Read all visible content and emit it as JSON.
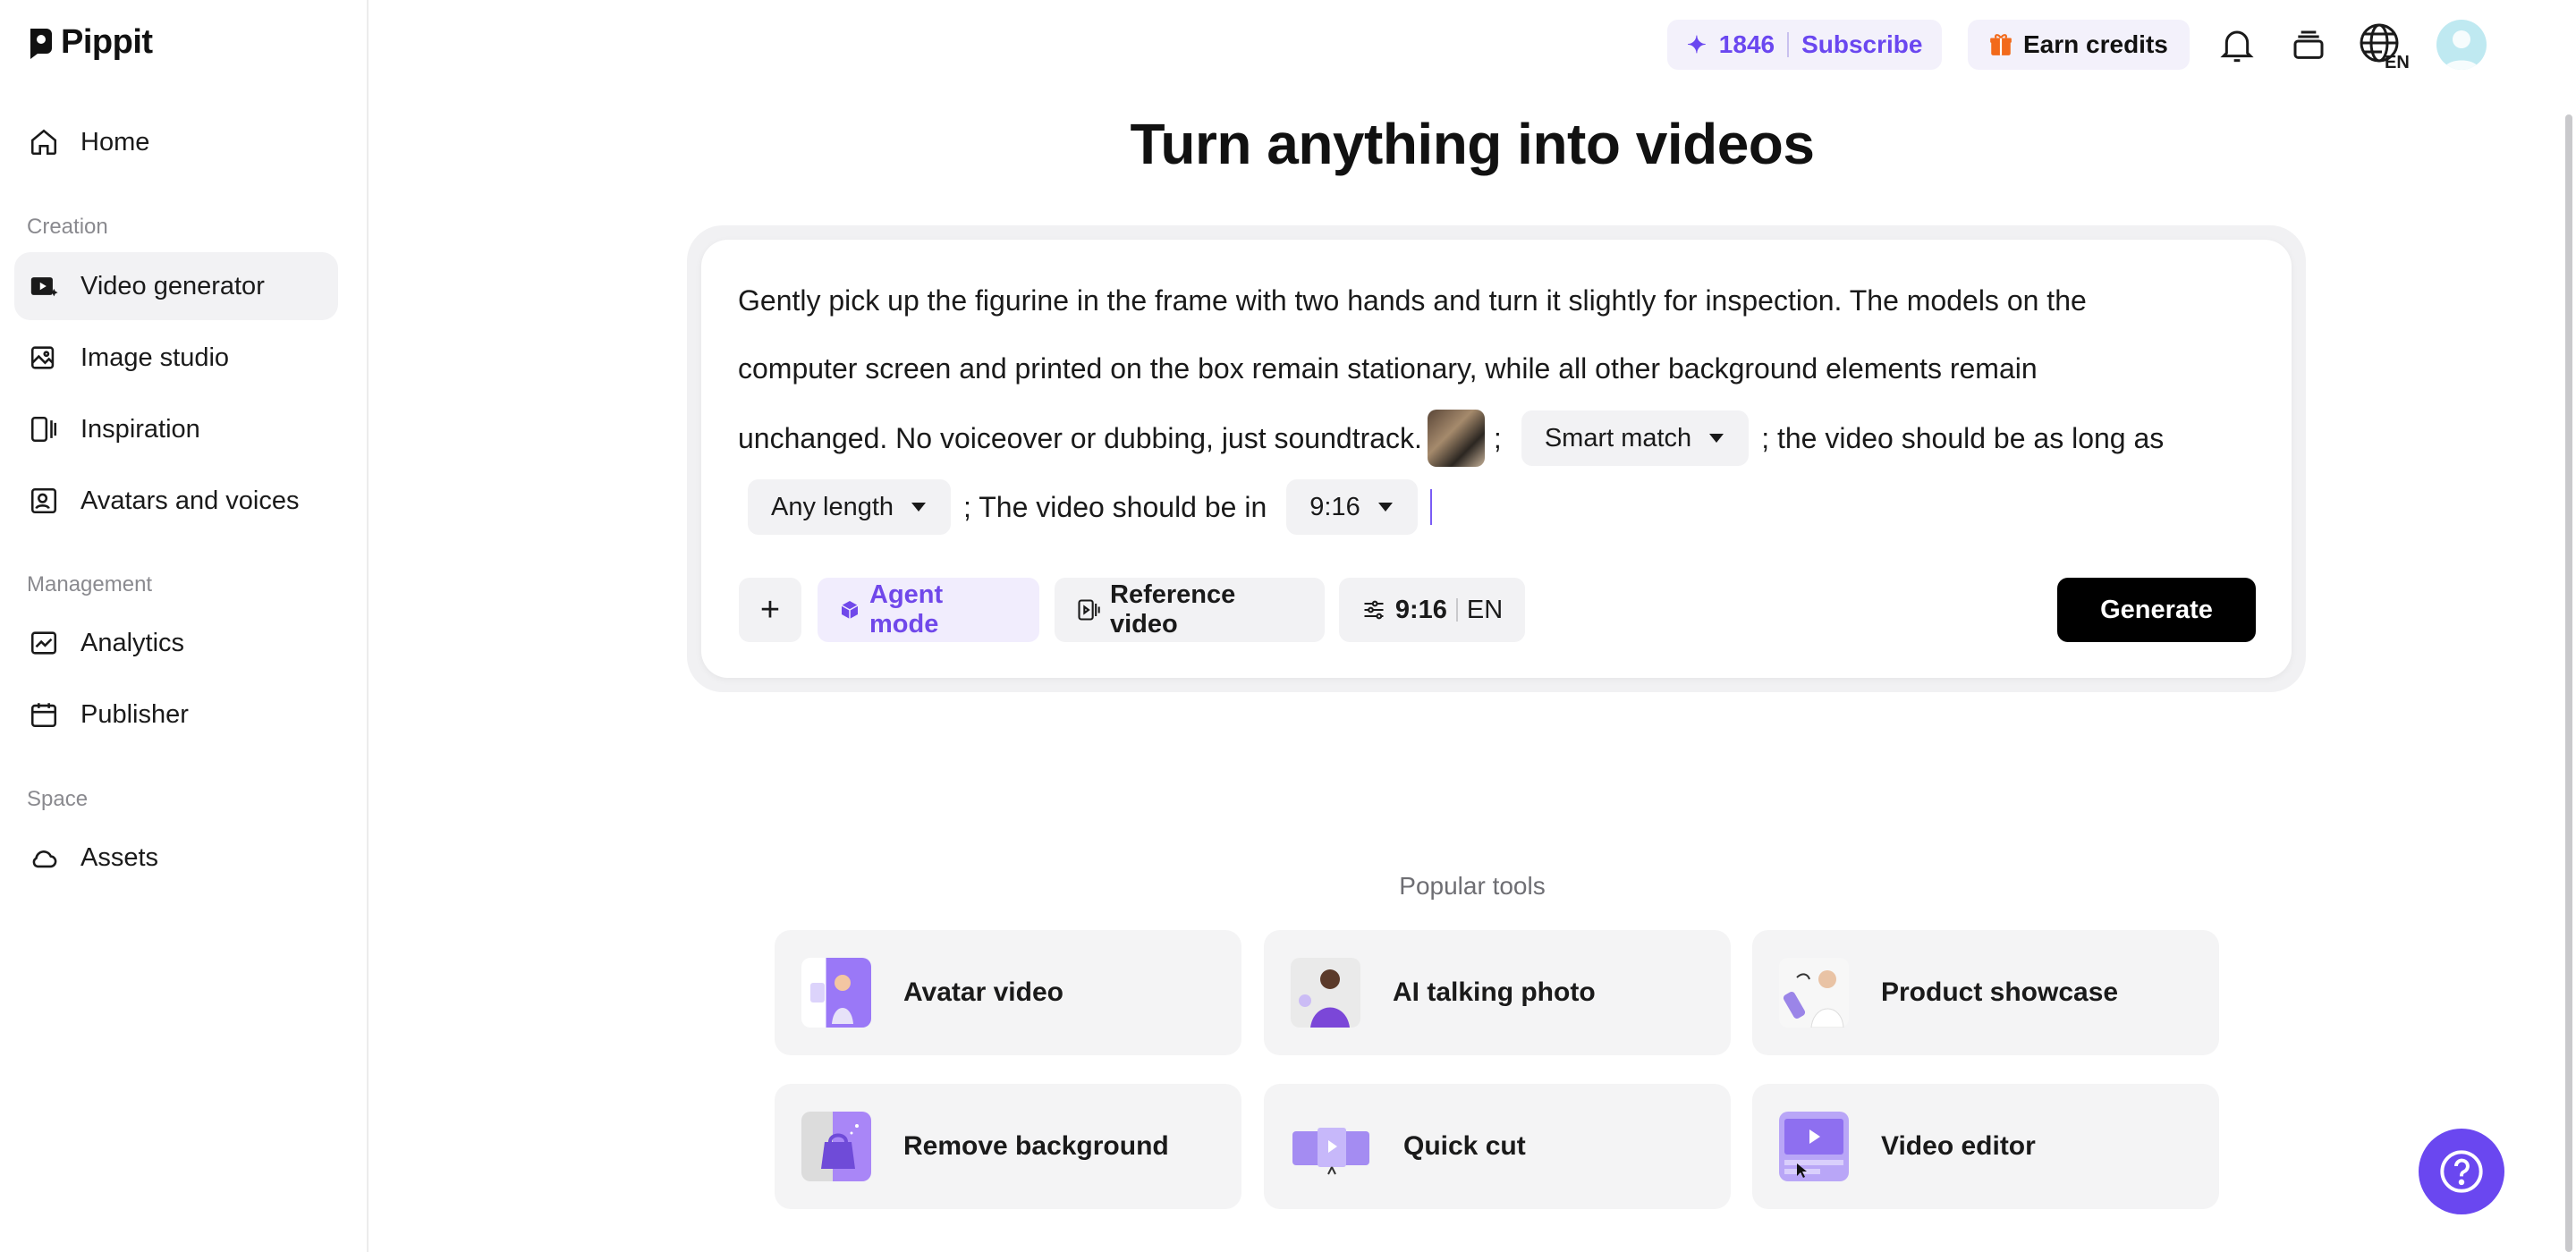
{
  "app": {
    "name": "Pippit"
  },
  "sidebar": {
    "home": "Home",
    "sections": {
      "creation": "Creation",
      "management": "Management",
      "space": "Space"
    },
    "items": {
      "video_generator": "Video generator",
      "image_studio": "Image studio",
      "inspiration": "Inspiration",
      "avatars_voices": "Avatars and voices",
      "analytics": "Analytics",
      "publisher": "Publisher",
      "assets": "Assets"
    },
    "active": "Video generator"
  },
  "topbar": {
    "credits": "1846",
    "subscribe": "Subscribe",
    "earn_credits": "Earn credits",
    "language": "EN"
  },
  "main": {
    "title": "Turn anything into videos",
    "prompt": {
      "line1": "Gently pick up the figurine in the frame with two hands and turn it slightly for inspection. The models on the",
      "line2": "computer screen and printed on the box remain stationary, while all other background elements remain",
      "line3_text": "unchanged. No voiceover or dubbing, just soundtrack.",
      "sep1": ";",
      "smart_match": "Smart match",
      "line3_tail": "; the video should be as long as",
      "any_length": "Any length",
      "line4_mid": "; The video should be in",
      "ratio": "9:16"
    },
    "toolbar": {
      "add": "+",
      "agent_mode": "Agent mode",
      "reference_video": "Reference video",
      "settings_ratio": "9:16",
      "settings_lang": "EN",
      "generate": "Generate"
    },
    "popular_tools": {
      "heading": "Popular tools",
      "items": [
        "Avatar video",
        "AI talking photo",
        "Product showcase",
        "Remove background",
        "Quick cut",
        "Video editor"
      ]
    }
  },
  "colors": {
    "accent": "#6a47f0",
    "agent_text": "#7048ea",
    "chip_bg": "#f2f2f4",
    "generate_bg": "#000000"
  }
}
